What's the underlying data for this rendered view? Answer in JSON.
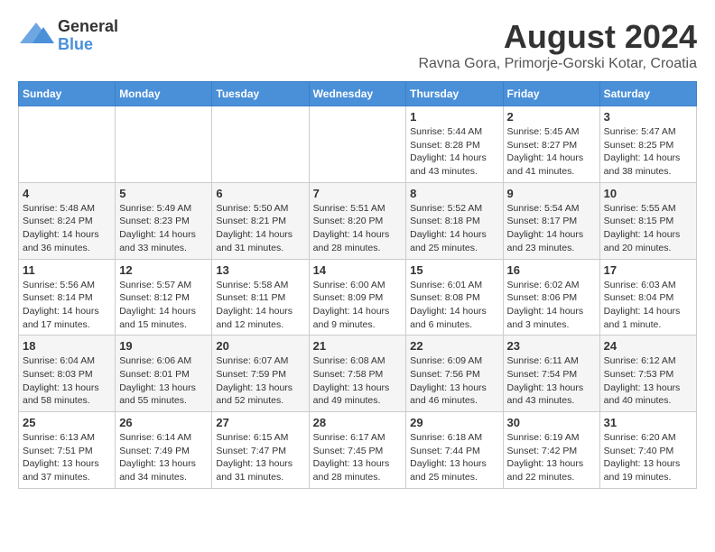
{
  "header": {
    "logo_general": "General",
    "logo_blue": "Blue",
    "month_year": "August 2024",
    "location": "Ravna Gora, Primorje-Gorski Kotar, Croatia"
  },
  "days_of_week": [
    "Sunday",
    "Monday",
    "Tuesday",
    "Wednesday",
    "Thursday",
    "Friday",
    "Saturday"
  ],
  "weeks": [
    [
      {
        "day": "",
        "info": ""
      },
      {
        "day": "",
        "info": ""
      },
      {
        "day": "",
        "info": ""
      },
      {
        "day": "",
        "info": ""
      },
      {
        "day": "1",
        "info": "Sunrise: 5:44 AM\nSunset: 8:28 PM\nDaylight: 14 hours\nand 43 minutes."
      },
      {
        "day": "2",
        "info": "Sunrise: 5:45 AM\nSunset: 8:27 PM\nDaylight: 14 hours\nand 41 minutes."
      },
      {
        "day": "3",
        "info": "Sunrise: 5:47 AM\nSunset: 8:25 PM\nDaylight: 14 hours\nand 38 minutes."
      }
    ],
    [
      {
        "day": "4",
        "info": "Sunrise: 5:48 AM\nSunset: 8:24 PM\nDaylight: 14 hours\nand 36 minutes."
      },
      {
        "day": "5",
        "info": "Sunrise: 5:49 AM\nSunset: 8:23 PM\nDaylight: 14 hours\nand 33 minutes."
      },
      {
        "day": "6",
        "info": "Sunrise: 5:50 AM\nSunset: 8:21 PM\nDaylight: 14 hours\nand 31 minutes."
      },
      {
        "day": "7",
        "info": "Sunrise: 5:51 AM\nSunset: 8:20 PM\nDaylight: 14 hours\nand 28 minutes."
      },
      {
        "day": "8",
        "info": "Sunrise: 5:52 AM\nSunset: 8:18 PM\nDaylight: 14 hours\nand 25 minutes."
      },
      {
        "day": "9",
        "info": "Sunrise: 5:54 AM\nSunset: 8:17 PM\nDaylight: 14 hours\nand 23 minutes."
      },
      {
        "day": "10",
        "info": "Sunrise: 5:55 AM\nSunset: 8:15 PM\nDaylight: 14 hours\nand 20 minutes."
      }
    ],
    [
      {
        "day": "11",
        "info": "Sunrise: 5:56 AM\nSunset: 8:14 PM\nDaylight: 14 hours\nand 17 minutes."
      },
      {
        "day": "12",
        "info": "Sunrise: 5:57 AM\nSunset: 8:12 PM\nDaylight: 14 hours\nand 15 minutes."
      },
      {
        "day": "13",
        "info": "Sunrise: 5:58 AM\nSunset: 8:11 PM\nDaylight: 14 hours\nand 12 minutes."
      },
      {
        "day": "14",
        "info": "Sunrise: 6:00 AM\nSunset: 8:09 PM\nDaylight: 14 hours\nand 9 minutes."
      },
      {
        "day": "15",
        "info": "Sunrise: 6:01 AM\nSunset: 8:08 PM\nDaylight: 14 hours\nand 6 minutes."
      },
      {
        "day": "16",
        "info": "Sunrise: 6:02 AM\nSunset: 8:06 PM\nDaylight: 14 hours\nand 3 minutes."
      },
      {
        "day": "17",
        "info": "Sunrise: 6:03 AM\nSunset: 8:04 PM\nDaylight: 14 hours\nand 1 minute."
      }
    ],
    [
      {
        "day": "18",
        "info": "Sunrise: 6:04 AM\nSunset: 8:03 PM\nDaylight: 13 hours\nand 58 minutes."
      },
      {
        "day": "19",
        "info": "Sunrise: 6:06 AM\nSunset: 8:01 PM\nDaylight: 13 hours\nand 55 minutes."
      },
      {
        "day": "20",
        "info": "Sunrise: 6:07 AM\nSunset: 7:59 PM\nDaylight: 13 hours\nand 52 minutes."
      },
      {
        "day": "21",
        "info": "Sunrise: 6:08 AM\nSunset: 7:58 PM\nDaylight: 13 hours\nand 49 minutes."
      },
      {
        "day": "22",
        "info": "Sunrise: 6:09 AM\nSunset: 7:56 PM\nDaylight: 13 hours\nand 46 minutes."
      },
      {
        "day": "23",
        "info": "Sunrise: 6:11 AM\nSunset: 7:54 PM\nDaylight: 13 hours\nand 43 minutes."
      },
      {
        "day": "24",
        "info": "Sunrise: 6:12 AM\nSunset: 7:53 PM\nDaylight: 13 hours\nand 40 minutes."
      }
    ],
    [
      {
        "day": "25",
        "info": "Sunrise: 6:13 AM\nSunset: 7:51 PM\nDaylight: 13 hours\nand 37 minutes."
      },
      {
        "day": "26",
        "info": "Sunrise: 6:14 AM\nSunset: 7:49 PM\nDaylight: 13 hours\nand 34 minutes."
      },
      {
        "day": "27",
        "info": "Sunrise: 6:15 AM\nSunset: 7:47 PM\nDaylight: 13 hours\nand 31 minutes."
      },
      {
        "day": "28",
        "info": "Sunrise: 6:17 AM\nSunset: 7:45 PM\nDaylight: 13 hours\nand 28 minutes."
      },
      {
        "day": "29",
        "info": "Sunrise: 6:18 AM\nSunset: 7:44 PM\nDaylight: 13 hours\nand 25 minutes."
      },
      {
        "day": "30",
        "info": "Sunrise: 6:19 AM\nSunset: 7:42 PM\nDaylight: 13 hours\nand 22 minutes."
      },
      {
        "day": "31",
        "info": "Sunrise: 6:20 AM\nSunset: 7:40 PM\nDaylight: 13 hours\nand 19 minutes."
      }
    ]
  ]
}
